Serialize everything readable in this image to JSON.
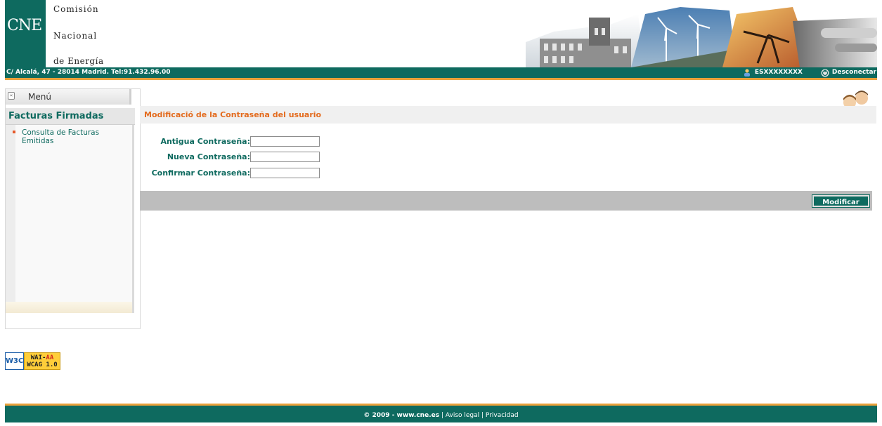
{
  "header": {
    "logo_text": "CNE",
    "org_line1": "Comisión",
    "org_line2": "Nacional",
    "org_line3": "de Energía",
    "address": "C/ Alcalá, 47 - 28014 Madrid. Tel:91.432.96.00",
    "user_id": "ESXXXXXXXX",
    "logout_label": "Desconectar"
  },
  "sidebar": {
    "menu_label": "Menú",
    "section_title": "Facturas Firmadas",
    "items": [
      {
        "label": "Consulta de Facturas Emitidas"
      }
    ]
  },
  "main": {
    "title": "Modificació de la Contraseña del usuario",
    "fields": {
      "old_password": {
        "label": "Antigua Contraseña:",
        "value": ""
      },
      "new_password": {
        "label": "Nueva Contraseña:",
        "value": ""
      },
      "confirm_password": {
        "label": "Confirmar Contraseña:",
        "value": ""
      }
    },
    "submit_label": "Modificar"
  },
  "badge": {
    "w3c": "W3C",
    "line1_black": "WAI-",
    "line1_red": "AA",
    "line2": "WCAG 1.0"
  },
  "footer": {
    "copyright": "© 2009 - www.cne.es",
    "legal": "Aviso legal",
    "privacy": "Privacidad"
  },
  "colors": {
    "brand_green": "#0e6a5f",
    "accent_orange": "#e9a13b",
    "title_orange": "#e36b1e"
  }
}
